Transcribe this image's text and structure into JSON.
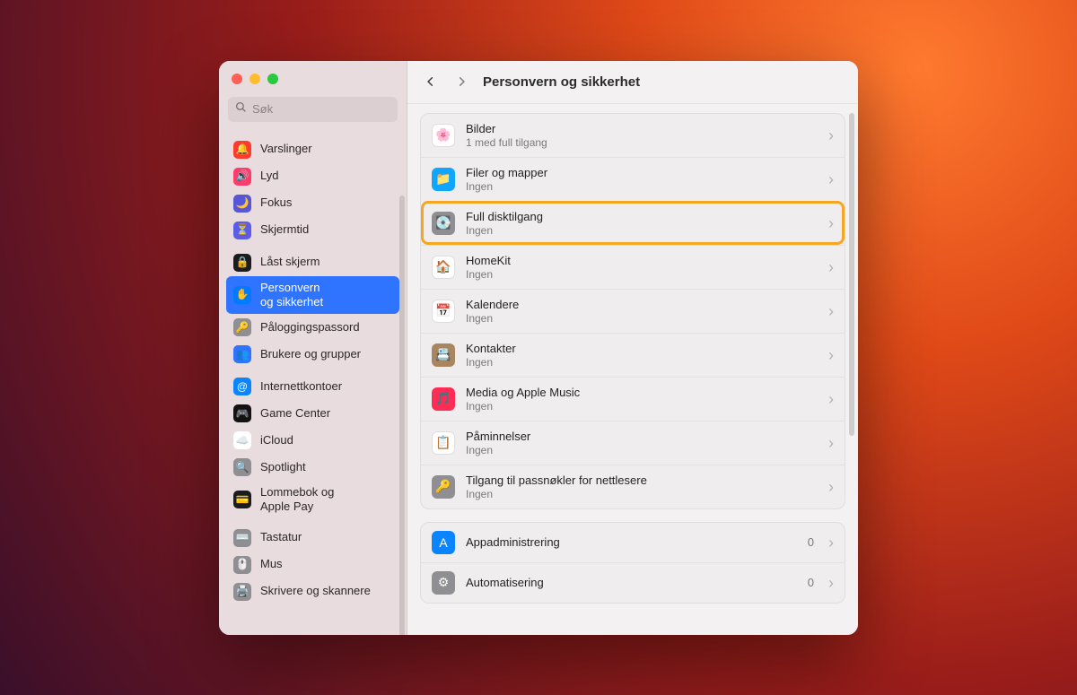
{
  "window": {
    "title": "Personvern og sikkerhet"
  },
  "search": {
    "placeholder": "Søk"
  },
  "sidebar": {
    "groups": [
      [
        {
          "label": "Varslinger",
          "icon": "🔔",
          "bg": "#ff3b30"
        },
        {
          "label": "Lyd",
          "icon": "🔊",
          "bg": "#ff3b6b"
        },
        {
          "label": "Fokus",
          "icon": "🌙",
          "bg": "#5856d6"
        },
        {
          "label": "Skjermtid",
          "icon": "⏳",
          "bg": "#5e5ce6"
        }
      ],
      [
        {
          "label": "Låst skjerm",
          "icon": "🔒",
          "bg": "#1c1c1e"
        },
        {
          "label": "Personvern\nog sikkerhet",
          "icon": "✋",
          "bg": "#007aff",
          "selected": true
        },
        {
          "label": "Påloggingspassord",
          "icon": "🔑",
          "bg": "#8e8e93"
        },
        {
          "label": "Brukere og grupper",
          "icon": "👥",
          "bg": "#2f74ff"
        }
      ],
      [
        {
          "label": "Internettkontoer",
          "icon": "@",
          "bg": "#0a84ff"
        },
        {
          "label": "Game Center",
          "icon": "🎮",
          "bg": "#121212"
        },
        {
          "label": "iCloud",
          "icon": "☁️",
          "bg": "#ffffff",
          "fg": "#0a84ff"
        },
        {
          "label": "Spotlight",
          "icon": "🔍",
          "bg": "#8e8e93"
        },
        {
          "label": "Lommebok og\nApple Pay",
          "icon": "💳",
          "bg": "#1c1c1e"
        }
      ],
      [
        {
          "label": "Tastatur",
          "icon": "⌨️",
          "bg": "#8e8e93"
        },
        {
          "label": "Mus",
          "icon": "🖱️",
          "bg": "#8e8e93"
        },
        {
          "label": "Skrivere og skannere",
          "icon": "🖨️",
          "bg": "#8e8e93"
        }
      ]
    ]
  },
  "main": {
    "sections": [
      [
        {
          "title": "Bilder",
          "sub": "1 med full tilgang",
          "icon": "🌸",
          "bg": "#ffffff"
        },
        {
          "title": "Filer og mapper",
          "sub": "Ingen",
          "icon": "📁",
          "bg": "#10a6ff"
        },
        {
          "title": "Full disktilgang",
          "sub": "Ingen",
          "icon": "💽",
          "bg": "#8e8e93",
          "highlight": true
        },
        {
          "title": "HomeKit",
          "sub": "Ingen",
          "icon": "🏠",
          "bg": "#ffffff",
          "fg": "#ff9500"
        },
        {
          "title": "Kalendere",
          "sub": "Ingen",
          "icon": "📅",
          "bg": "#ffffff"
        },
        {
          "title": "Kontakter",
          "sub": "Ingen",
          "icon": "📇",
          "bg": "#a9865f"
        },
        {
          "title": "Media og Apple Music",
          "sub": "Ingen",
          "icon": "🎵",
          "bg": "#ff2d55"
        },
        {
          "title": "Påminnelser",
          "sub": "Ingen",
          "icon": "📋",
          "bg": "#ffffff"
        },
        {
          "title": "Tilgang til passnøkler for nettlesere",
          "sub": "Ingen",
          "icon": "🔑",
          "bg": "#8e8e93"
        }
      ],
      [
        {
          "title": "Appadministrering",
          "count": "0",
          "icon": "A",
          "bg": "#0a84ff"
        },
        {
          "title": "Automatisering",
          "count": "0",
          "icon": "⚙︎",
          "bg": "#8e8e93"
        }
      ]
    ]
  }
}
